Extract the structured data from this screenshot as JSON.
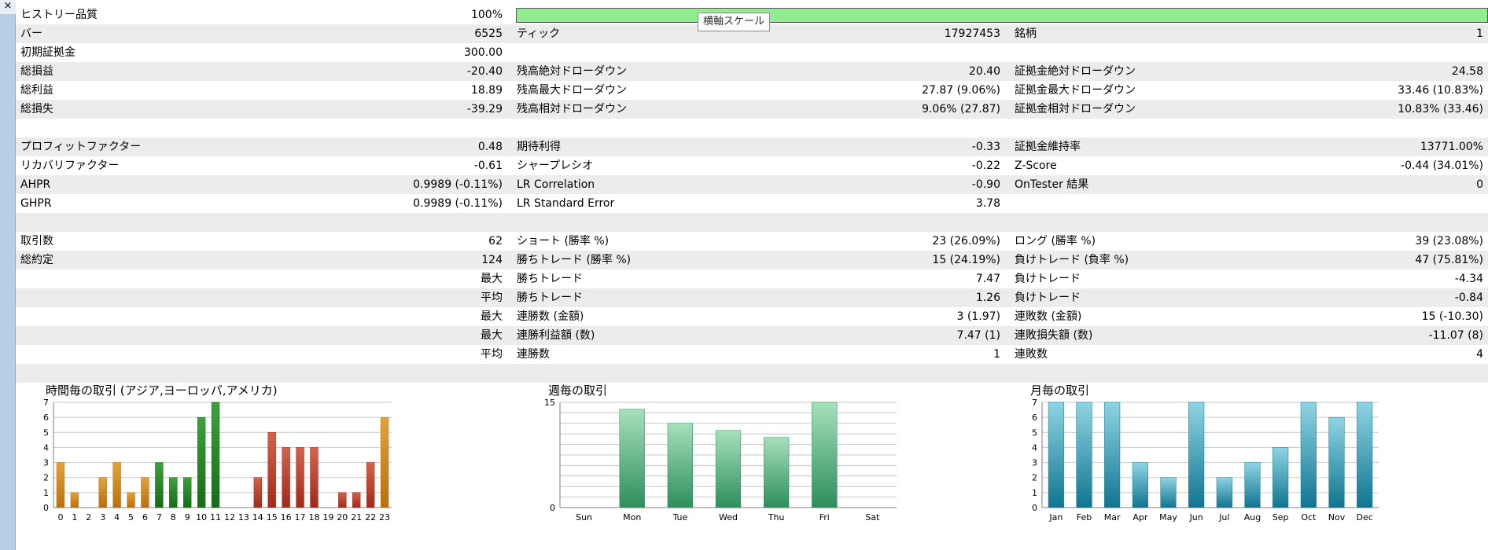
{
  "window": {
    "close_glyph": "×"
  },
  "tooltip": "横軸スケール",
  "stats": {
    "history_quality": {
      "label": "ヒストリー品質",
      "value": "100%",
      "fill_fraction": 1.0
    },
    "rows": [
      {
        "c1": [
          "バー",
          "6525"
        ],
        "c2": [
          "ティック",
          "17927453"
        ],
        "c3": [
          "銘柄",
          "1"
        ]
      },
      {
        "c1": [
          "初期証拠金",
          "300.00"
        ],
        "c2": [
          "",
          ""
        ],
        "c3": [
          "",
          ""
        ]
      },
      {
        "c1": [
          "総損益",
          "-20.40"
        ],
        "c2": [
          "残高絶対ドローダウン",
          "20.40"
        ],
        "c3": [
          "証拠金絶対ドローダウン",
          "24.58"
        ]
      },
      {
        "c1": [
          "総利益",
          "18.89"
        ],
        "c2": [
          "残高最大ドローダウン",
          "27.87 (9.06%)"
        ],
        "c3": [
          "証拠金最大ドローダウン",
          "33.46 (10.83%)"
        ]
      },
      {
        "c1": [
          "総損失",
          "-39.29"
        ],
        "c2": [
          "残高相対ドローダウン",
          "9.06% (27.87)"
        ],
        "c3": [
          "証拠金相対ドローダウン",
          "10.83% (33.46)"
        ]
      },
      {
        "c1": [
          "",
          ""
        ],
        "c2": [
          "",
          ""
        ],
        "c3": [
          "",
          ""
        ]
      },
      {
        "c1": [
          "プロフィットファクター",
          "0.48"
        ],
        "c2": [
          "期待利得",
          "-0.33"
        ],
        "c3": [
          "証拠金維持率",
          "13771.00%"
        ]
      },
      {
        "c1": [
          "リカバリファクター",
          "-0.61"
        ],
        "c2": [
          "シャープレシオ",
          "-0.22"
        ],
        "c3": [
          "Z-Score",
          "-0.44 (34.01%)"
        ]
      },
      {
        "c1": [
          "AHPR",
          "0.9989 (-0.11%)"
        ],
        "c2": [
          "LR Correlation",
          "-0.90"
        ],
        "c3": [
          "OnTester 結果",
          "0"
        ]
      },
      {
        "c1": [
          "GHPR",
          "0.9989 (-0.11%)"
        ],
        "c2": [
          "LR Standard Error",
          "3.78"
        ],
        "c3": [
          "",
          ""
        ]
      },
      {
        "c1": [
          "",
          ""
        ],
        "c2": [
          "",
          ""
        ],
        "c3": [
          "",
          ""
        ]
      },
      {
        "c1": [
          "取引数",
          "62"
        ],
        "c2": [
          "ショート (勝率 %)",
          "23 (26.09%)"
        ],
        "c3": [
          "ロング (勝率 %)",
          "39 (23.08%)"
        ]
      },
      {
        "c1": [
          "総約定",
          "124"
        ],
        "c2": [
          "勝ちトレード (勝率 %)",
          "15 (24.19%)"
        ],
        "c3": [
          "負けトレード (負率 %)",
          "47 (75.81%)"
        ]
      },
      {
        "c1": [
          "",
          "最大"
        ],
        "c2": [
          "勝ちトレード",
          "7.47"
        ],
        "c3": [
          "負けトレード",
          "-4.34"
        ]
      },
      {
        "c1": [
          "",
          "平均"
        ],
        "c2": [
          "勝ちトレード",
          "1.26"
        ],
        "c3": [
          "負けトレード",
          "-0.84"
        ]
      },
      {
        "c1": [
          "",
          "最大"
        ],
        "c2": [
          "連勝数 (金額)",
          "3 (1.97)"
        ],
        "c3": [
          "連敗数 (金額)",
          "15 (-10.30)"
        ]
      },
      {
        "c1": [
          "",
          "最大"
        ],
        "c2": [
          "連勝利益額 (数)",
          "7.47 (1)"
        ],
        "c3": [
          "連敗損失額 (数)",
          "-11.07 (8)"
        ]
      },
      {
        "c1": [
          "",
          "平均"
        ],
        "c2": [
          "連勝数",
          "1"
        ],
        "c3": [
          "連敗数",
          "4"
        ]
      },
      {
        "c1": [
          "",
          ""
        ],
        "c2": [
          "",
          ""
        ],
        "c3": [
          "",
          ""
        ]
      }
    ]
  },
  "colors": {
    "quality_bar": "#90ee90",
    "asia": [
      "#e3a23c",
      "#b8700c"
    ],
    "europe": [
      "#3ea13e",
      "#146d14"
    ],
    "america": [
      "#d4644a",
      "#a3281a"
    ],
    "week": [
      "#a6e0bc",
      "#2d8e5c"
    ],
    "month": [
      "#8fd4e4",
      "#107590"
    ],
    "grid": "#c8c8c8",
    "axis": "#7f7f7f"
  },
  "chart_data": [
    {
      "type": "bar",
      "title": "時間毎の取引 (アジア,ヨーロッパ,アメリカ)",
      "categories": [
        "0",
        "1",
        "2",
        "3",
        "4",
        "5",
        "6",
        "7",
        "8",
        "9",
        "10",
        "11",
        "12",
        "13",
        "14",
        "15",
        "16",
        "17",
        "18",
        "19",
        "20",
        "21",
        "22",
        "23"
      ],
      "values": [
        3,
        1,
        0,
        2,
        3,
        1,
        2,
        3,
        2,
        2,
        6,
        7,
        0,
        0,
        2,
        5,
        4,
        4,
        4,
        0,
        1,
        1,
        3,
        6
      ],
      "session": [
        "asia",
        "asia",
        "asia",
        "asia",
        "asia",
        "asia",
        "asia",
        "europe",
        "europe",
        "europe",
        "europe",
        "europe",
        "america",
        "america",
        "america",
        "america",
        "america",
        "america",
        "america",
        "america",
        "america",
        "america",
        "america",
        "asia"
      ],
      "yticks": [
        0,
        1,
        2,
        3,
        4,
        5,
        6,
        7
      ],
      "ylim": [
        0,
        7
      ],
      "grid": true
    },
    {
      "type": "bar",
      "title": "週毎の取引",
      "categories": [
        "Sun",
        "Mon",
        "Tue",
        "Wed",
        "Thu",
        "Fri",
        "Sat"
      ],
      "values": [
        0,
        14,
        12,
        11,
        10,
        15,
        0
      ],
      "yticks": [
        0,
        15
      ],
      "ylim": [
        0,
        15
      ],
      "grid": true
    },
    {
      "type": "bar",
      "title": "月毎の取引",
      "categories": [
        "Jan",
        "Feb",
        "Mar",
        "Apr",
        "May",
        "Jun",
        "Jul",
        "Aug",
        "Sep",
        "Oct",
        "Nov",
        "Dec"
      ],
      "values": [
        7,
        7,
        7,
        3,
        2,
        7,
        2,
        3,
        4,
        7,
        6,
        7
      ],
      "yticks": [
        0,
        1,
        2,
        3,
        4,
        5,
        6,
        7
      ],
      "ylim": [
        0,
        7
      ],
      "grid": true
    }
  ]
}
